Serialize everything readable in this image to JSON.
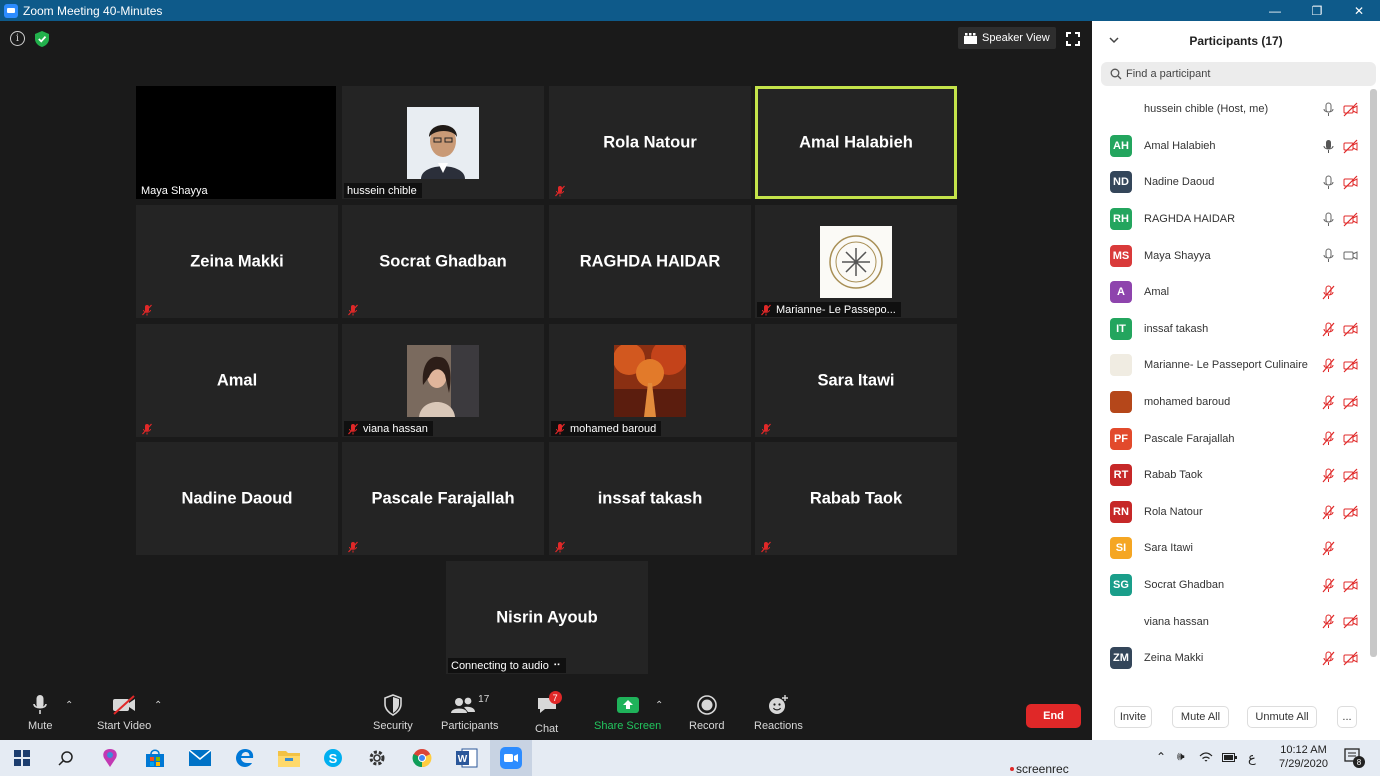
{
  "window": {
    "title": "Zoom Meeting 40-Minutes",
    "controls": [
      "—",
      "❐",
      "✕"
    ]
  },
  "view": {
    "speaker_view_label": "Speaker View"
  },
  "tiles": [
    {
      "name": "Maya Shayya",
      "kind": "video-black",
      "muted": false
    },
    {
      "name": "hussein chible",
      "kind": "photo",
      "muted": false
    },
    {
      "name": "Rola Natour",
      "kind": "name",
      "muted": true
    },
    {
      "name": "Amal Halabieh",
      "kind": "name",
      "muted": false,
      "active": true
    },
    {
      "name": "Zeina Makki",
      "kind": "name",
      "muted": true
    },
    {
      "name": "Socrat Ghadban",
      "kind": "name",
      "muted": true
    },
    {
      "name": "RAGHDA HAIDAR",
      "kind": "name",
      "muted": false
    },
    {
      "name": "Marianne- Le Passepo...",
      "kind": "logo",
      "muted": true
    },
    {
      "name": "Amal",
      "kind": "name",
      "muted": true
    },
    {
      "name": "viana hassan",
      "kind": "photo2",
      "muted": true
    },
    {
      "name": "mohamed baroud",
      "kind": "photo3",
      "muted": true
    },
    {
      "name": "Sara Itawi",
      "kind": "name",
      "muted": true
    },
    {
      "name": "Nadine Daoud",
      "kind": "name",
      "muted": false
    },
    {
      "name": "Pascale Farajallah",
      "kind": "name",
      "muted": true
    },
    {
      "name": "inssaf takash",
      "kind": "name",
      "muted": true
    },
    {
      "name": "Rabab Taok",
      "kind": "name",
      "muted": true
    },
    {
      "name": "Nisrin Ayoub",
      "kind": "name",
      "muted": false,
      "status": "Connecting to audio"
    }
  ],
  "toolbar": {
    "mute": "Mute",
    "start_video": "Start Video",
    "security": "Security",
    "participants": "Participants",
    "participants_count": "17",
    "chat": "Chat",
    "chat_badge": "7",
    "share_screen": "Share Screen",
    "record": "Record",
    "reactions": "Reactions",
    "end": "End"
  },
  "panel": {
    "title": "Participants (17)",
    "search_placeholder": "Find a participant",
    "participants": [
      {
        "initials": "",
        "name": "hussein chible (Host, me)",
        "color": "#ffffff",
        "avatar": "photo",
        "mic": "on",
        "video": "off"
      },
      {
        "initials": "AH",
        "name": "Amal Halabieh",
        "color": "#23a55e",
        "mic": "speaking",
        "video": "off"
      },
      {
        "initials": "ND",
        "name": "Nadine Daoud",
        "color": "#34465a",
        "mic": "on",
        "video": "off"
      },
      {
        "initials": "RH",
        "name": "RAGHDA HAIDAR",
        "color": "#23a55e",
        "mic": "on",
        "video": "off"
      },
      {
        "initials": "MS",
        "name": "Maya Shayya",
        "color": "#d93a3a",
        "mic": "on",
        "video": "on"
      },
      {
        "initials": "A",
        "name": "Amal",
        "color": "#8e44ad",
        "mic": "muted",
        "video": "none"
      },
      {
        "initials": "IT",
        "name": "inssaf takash",
        "color": "#23a55e",
        "mic": "muted",
        "video": "off"
      },
      {
        "initials": "",
        "name": "Marianne- Le Passeport Culinaire",
        "color": "#f0ece2",
        "avatar": "logo",
        "mic": "muted",
        "video": "off"
      },
      {
        "initials": "",
        "name": "mohamed baroud",
        "color": "#b5471a",
        "avatar": "photo3",
        "mic": "muted",
        "video": "off"
      },
      {
        "initials": "PF",
        "name": "Pascale Farajallah",
        "color": "#e24a2c",
        "mic": "muted",
        "video": "off"
      },
      {
        "initials": "RT",
        "name": "Rabab Taok",
        "color": "#c62828",
        "mic": "muted",
        "video": "off"
      },
      {
        "initials": "RN",
        "name": "Rola Natour",
        "color": "#c62828",
        "mic": "muted",
        "video": "off"
      },
      {
        "initials": "SI",
        "name": "Sara Itawi",
        "color": "#f5a623",
        "mic": "muted",
        "video": "none"
      },
      {
        "initials": "SG",
        "name": "Socrat Ghadban",
        "color": "#1a9e8a",
        "mic": "muted",
        "video": "off"
      },
      {
        "initials": "",
        "name": "viana hassan",
        "color": "#ffffff",
        "avatar": "photo2",
        "mic": "muted",
        "video": "off"
      },
      {
        "initials": "ZM",
        "name": "Zeina Makki",
        "color": "#34465a",
        "mic": "muted",
        "video": "off"
      }
    ],
    "buttons": {
      "invite": "Invite",
      "mute_all": "Mute All",
      "unmute_all": "Unmute All",
      "more": "..."
    }
  },
  "taskbar": {
    "apps": [
      "windows-start",
      "search",
      "cortana",
      "store",
      "mail",
      "edge",
      "file-explorer",
      "skype",
      "settings",
      "chrome",
      "word",
      "zoom"
    ],
    "watermark": "screenrec",
    "lang": "ع",
    "time": "10:12 AM",
    "date": "7/29/2020",
    "notification_count": "8"
  }
}
